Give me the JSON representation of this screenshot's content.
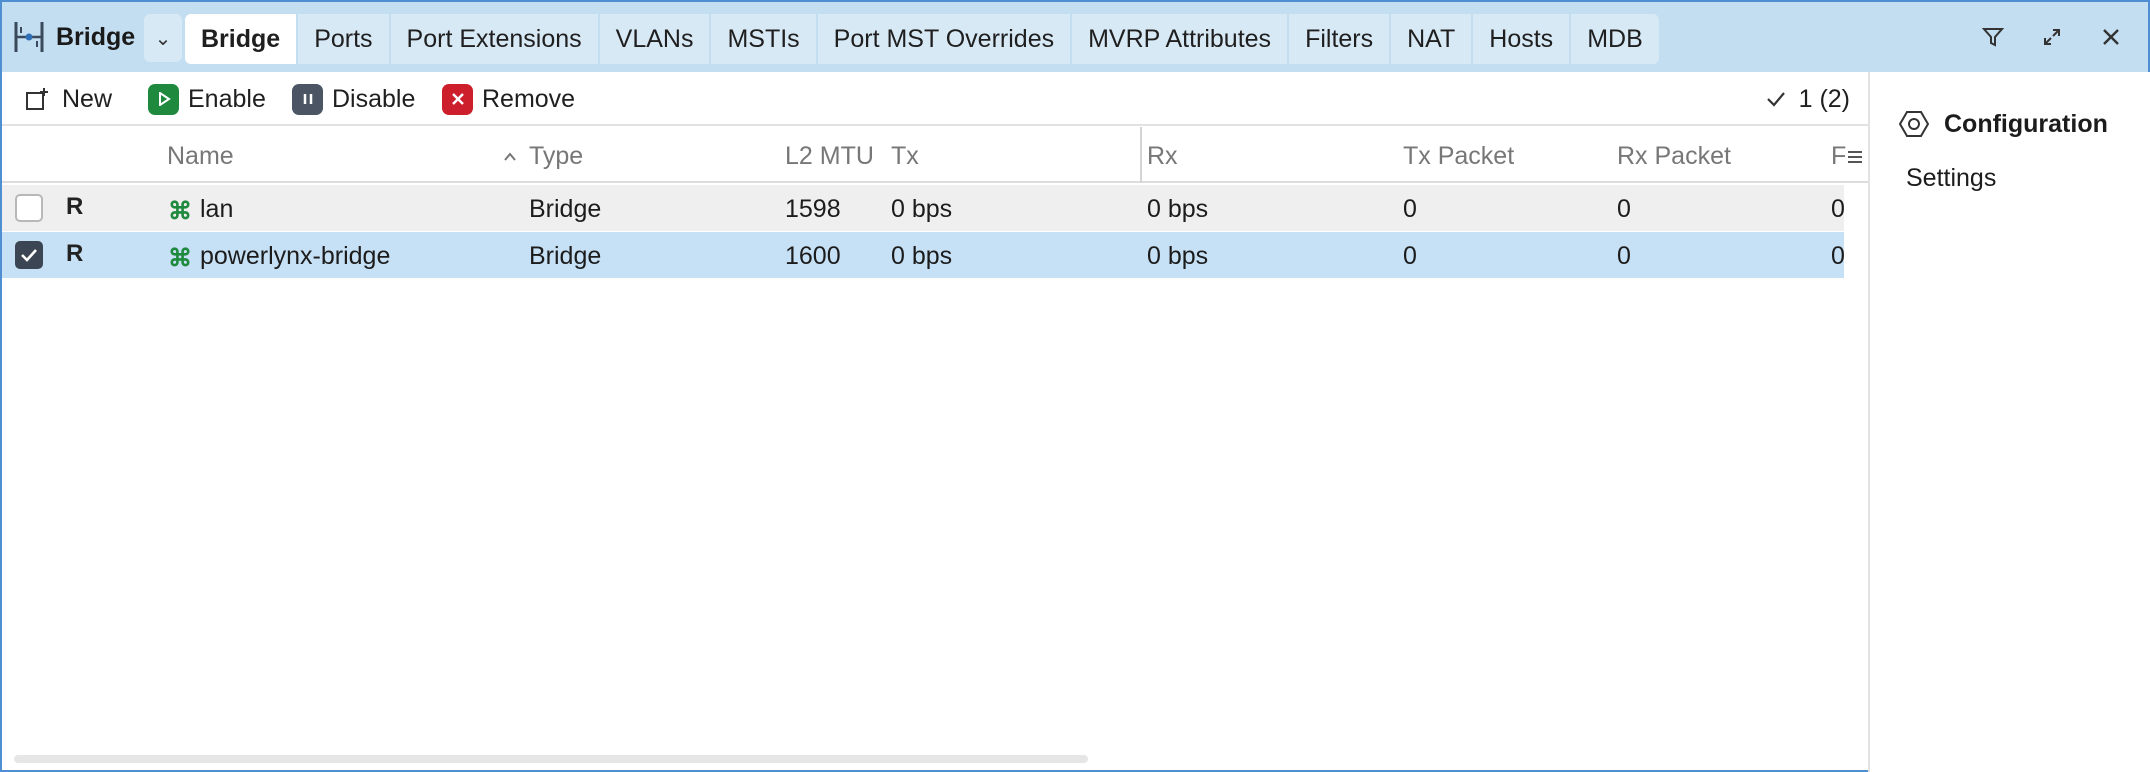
{
  "app": {
    "title": "Bridge",
    "icon": "bridge-icon"
  },
  "tabs": [
    {
      "label": "Bridge",
      "active": true
    },
    {
      "label": "Ports"
    },
    {
      "label": "Port Extensions"
    },
    {
      "label": "VLANs"
    },
    {
      "label": "MSTIs"
    },
    {
      "label": "Port MST Overrides"
    },
    {
      "label": "MVRP Attributes"
    },
    {
      "label": "Filters"
    },
    {
      "label": "NAT"
    },
    {
      "label": "Hosts"
    },
    {
      "label": "MDB"
    }
  ],
  "window_controls": [
    "filter-icon",
    "maximize-icon",
    "close-icon"
  ],
  "toolbar": {
    "new_label": "New",
    "enable_label": "Enable",
    "disable_label": "Disable",
    "remove_label": "Remove",
    "count": "1 (2)"
  },
  "columns": {
    "name": "Name",
    "type": "Type",
    "l2mtu": "L2 MTU",
    "tx": "Tx",
    "rx": "Rx",
    "tx_packet": "Tx Packet",
    "rx_packet": "Rx Packet",
    "more": "F"
  },
  "rows": [
    {
      "checked": false,
      "flag": "R",
      "name": "lan",
      "type": "Bridge",
      "l2mtu": "1598",
      "tx": "0 bps",
      "rx": "0 bps",
      "tx_packet": "0",
      "rx_packet": "0",
      "more": "0"
    },
    {
      "checked": true,
      "flag": "R",
      "name": "powerlynx-bridge",
      "type": "Bridge",
      "l2mtu": "1600",
      "tx": "0 bps",
      "rx": "0 bps",
      "tx_packet": "0",
      "rx_packet": "0",
      "more": "0"
    }
  ],
  "side": {
    "heading": "Configuration",
    "item": "Settings"
  },
  "colors": {
    "accent": "#4f8fd1",
    "titlebar": "#c3ddf1",
    "selected_row": "#c6e1f5",
    "green": "#1f8a3e",
    "red": "#cc1e2b"
  }
}
